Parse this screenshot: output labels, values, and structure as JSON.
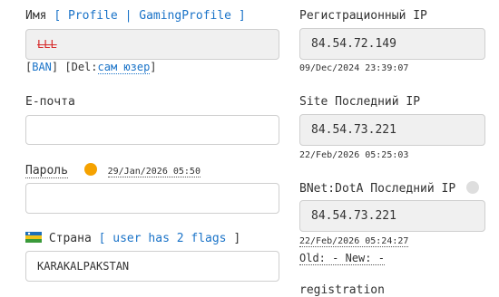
{
  "name": {
    "label": "Имя",
    "bracket_open": "[",
    "profile_link": "Profile",
    "separator": "|",
    "gaming_profile_link": "GamingProfile",
    "bracket_close": "]",
    "value": "LLL"
  },
  "ban": {
    "open": "[",
    "ban_link": "BAN",
    "mid": "] [Del:",
    "delete_link": "сам юзер",
    "close": "]"
  },
  "email": {
    "label": "E-почта",
    "value": ""
  },
  "password": {
    "label": "Пароль",
    "date": "29/Jan/2026 05:50",
    "value": ""
  },
  "country": {
    "label": "Страна",
    "open": "[",
    "flags_link": "user has 2 flags",
    "close": "]",
    "value": "KARAKALPAKSTAN"
  },
  "registration_ip": {
    "label": "Регистрационный IP",
    "value": "84.54.72.149",
    "date": "09/Dec/2024 23:39:07"
  },
  "site_last_ip": {
    "label": "Site Последний IP",
    "value": "84.54.73.221",
    "date": "22/Feb/2026 05:25:03"
  },
  "bnet_dota_ip": {
    "label": "BNet:DotA Последний IP",
    "value": "84.54.73.221",
    "date": "22/Feb/2026 05:24:27"
  },
  "old_new": {
    "old_label": "Old:",
    "old_value": "-",
    "new_label": "New:",
    "new_value": "-"
  },
  "registration": {
    "label": "registration"
  },
  "colors": {
    "link": "#1a73c8",
    "banned_text": "#d62828",
    "online_dot": "#f5a200",
    "offline_dot": "#dedede",
    "readonly_bg": "#f0f0f0"
  },
  "icons": {
    "password_status": "orange-status-dot",
    "bnet_status": "grey-status-dot",
    "country_flag": "karakalpakstan-flag-icon"
  }
}
